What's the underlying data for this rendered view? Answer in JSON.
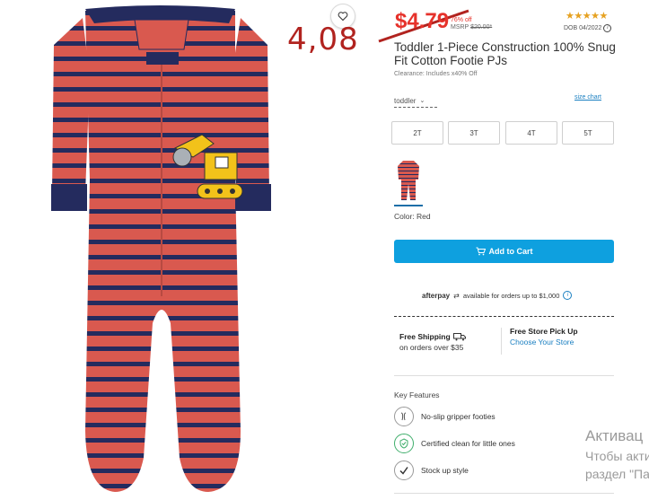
{
  "overlay": {
    "handwritten_price": "4,08"
  },
  "product": {
    "price": "$4.79",
    "discount": "76% off",
    "msrp_label": "MSRP",
    "msrp_value": "$20.00*",
    "rating_stars": "★★★★★",
    "dob": "DOB 04/2022",
    "title": "Toddler 1-Piece Construction 100% Snug Fit Cotton Footie PJs",
    "clearance_note": "Clearance: Includes x40% Off",
    "color_label": "Color: Red",
    "colors": {
      "accent": "#0ea0df",
      "sale": "#e6322b",
      "link": "#1a7fc1",
      "stripe_red": "#d9594f",
      "stripe_navy": "#242b5e"
    }
  },
  "size": {
    "type_select": "toddler",
    "chart_link": "size chart",
    "options": [
      "2T",
      "3T",
      "4T",
      "5T"
    ]
  },
  "cart": {
    "add_label": "Add to Cart"
  },
  "afterpay": {
    "logo": "afterpay",
    "text": "available for orders up to $1,000"
  },
  "shipping": {
    "free_title": "Free Shipping",
    "free_sub": "on orders over $35",
    "pickup_title": "Free Store Pick Up",
    "pickup_link": "Choose Your Store"
  },
  "key_features": {
    "title": "Key Features",
    "items": [
      {
        "label": "No-slip gripper footies",
        "icon": "footprint-icon"
      },
      {
        "label": "Certified clean for little ones",
        "icon": "shield-check-icon"
      },
      {
        "label": "Stock up style",
        "icon": "checkmark-icon"
      }
    ]
  },
  "watermark": {
    "title": "Активац",
    "line1": "Чтобы акти",
    "line2": "раздел \"Па"
  }
}
